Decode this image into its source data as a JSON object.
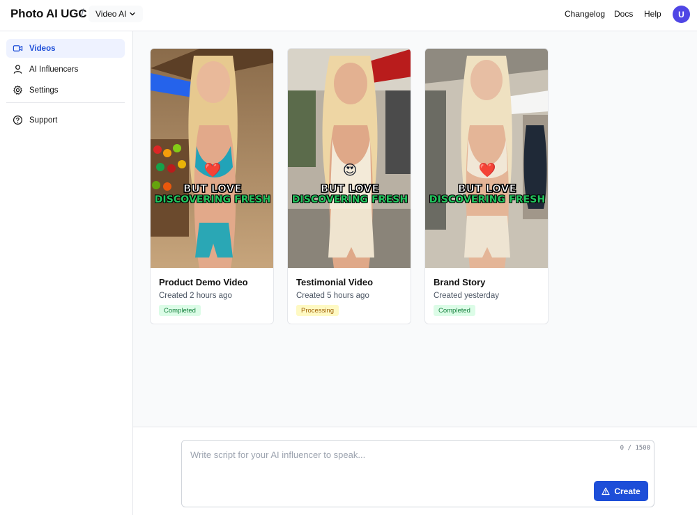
{
  "header": {
    "brand": "Photo AI UGC",
    "separator": "/",
    "product_selector": "Video AI",
    "links": {
      "changelog": "Changelog",
      "docs": "Docs",
      "help": "Help"
    },
    "avatar_initial": "U"
  },
  "sidebar": {
    "items": [
      {
        "label": "Videos",
        "icon": "video-camera-icon",
        "active": true
      },
      {
        "label": "AI Influencers",
        "icon": "user-icon",
        "active": false
      },
      {
        "label": "Settings",
        "icon": "gear-icon",
        "active": false
      }
    ],
    "support": {
      "label": "Support",
      "icon": "question-circle-icon"
    }
  },
  "videos": [
    {
      "title": "Product Demo Video",
      "created": "Created 2 hours ago",
      "status": "Completed",
      "thumb_caption_1": "BUT LOVE",
      "thumb_caption_2": "DISCOVERING FRESH",
      "thumb_emoji": "❤️"
    },
    {
      "title": "Testimonial Video",
      "created": "Created 5 hours ago",
      "status": "Processing",
      "thumb_caption_1": "BUT LOVE",
      "thumb_caption_2": "DISCOVERING FRESH",
      "thumb_emoji": "😍"
    },
    {
      "title": "Brand Story",
      "created": "Created yesterday",
      "status": "Completed",
      "thumb_caption_1": "BUT LOVE",
      "thumb_caption_2": "DISCOVERING FRESH",
      "thumb_emoji": "❤️"
    }
  ],
  "composer": {
    "placeholder": "Write script for your AI influencer to speak...",
    "value": "",
    "counter": "0 / 1500",
    "create_label": "Create"
  },
  "colors": {
    "accent": "#1d4ed8",
    "avatar": "#4f46e5",
    "completed_bg": "#dcfce7",
    "processing_bg": "#fef9c3"
  }
}
